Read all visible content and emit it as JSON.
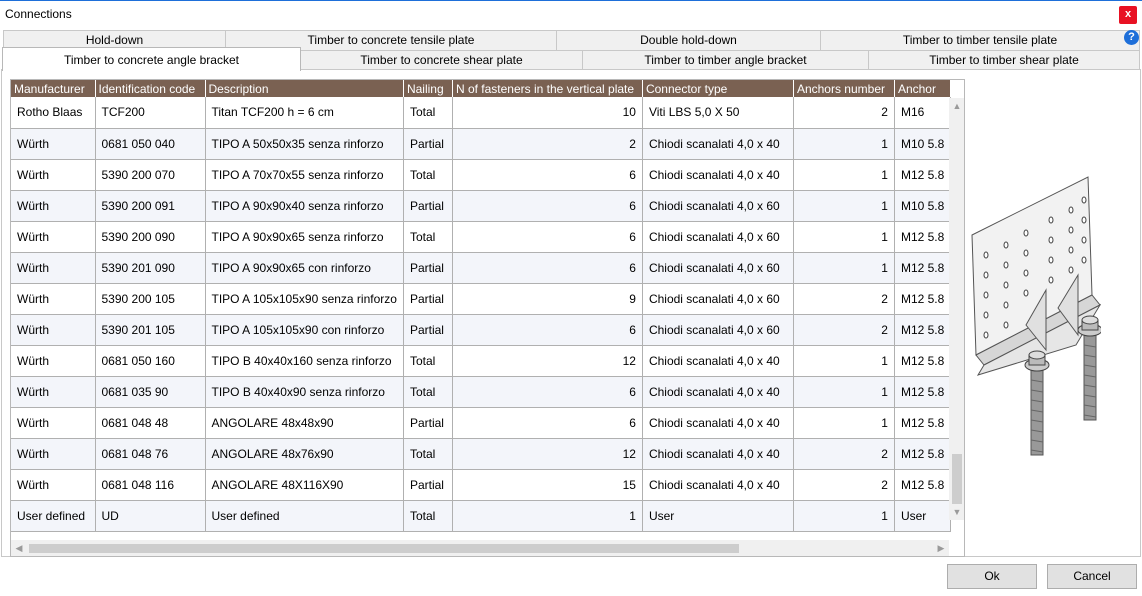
{
  "window": {
    "title": "Connections",
    "close_label": "x"
  },
  "tabs_row1": [
    {
      "label": "Hold-down"
    },
    {
      "label": "Timber to concrete tensile plate"
    },
    {
      "label": "Double hold-down"
    },
    {
      "label": "Timber to timber tensile plate"
    }
  ],
  "tabs_row2": [
    {
      "label": "Timber to concrete angle bracket",
      "active": true
    },
    {
      "label": "Timber to concrete shear plate"
    },
    {
      "label": "Timber to timber angle bracket"
    },
    {
      "label": "Timber to timber shear plate"
    }
  ],
  "help_icon": "?",
  "table": {
    "columns": [
      "Manufacturer",
      "Identification code",
      "Description",
      "Nailing",
      "N of fasteners in the vertical plate",
      "Connector type",
      "Anchors number",
      "Anchor"
    ],
    "rows": [
      [
        "Rotho Blaas",
        "TCF200",
        "Titan TCF200 h = 6 cm",
        "Total",
        "10",
        "Viti LBS 5,0 X 50",
        "2",
        "M16"
      ],
      [
        "Würth",
        "0681 050 040",
        "TIPO A 50x50x35 senza rinforzo",
        "Partial",
        "2",
        "Chiodi scanalati 4,0 x 40",
        "1",
        "M10 5.8"
      ],
      [
        "Würth",
        "5390 200 070",
        "TIPO A 70x70x55 senza rinforzo",
        "Total",
        "6",
        "Chiodi scanalati 4,0 x 40",
        "1",
        "M12 5.8"
      ],
      [
        "Würth",
        "5390 200 091",
        "TIPO A 90x90x40 senza rinforzo",
        "Partial",
        "6",
        "Chiodi scanalati 4,0 x 60",
        "1",
        "M10 5.8"
      ],
      [
        "Würth",
        "5390 200 090",
        "TIPO A 90x90x65 senza rinforzo",
        "Total",
        "6",
        "Chiodi scanalati 4,0 x 60",
        "1",
        "M12 5.8"
      ],
      [
        "Würth",
        "5390 201 090",
        "TIPO A 90x90x65 con rinforzo",
        "Partial",
        "6",
        "Chiodi scanalati 4,0 x 60",
        "1",
        "M12 5.8"
      ],
      [
        "Würth",
        "5390 200 105",
        "TIPO A 105x105x90 senza rinforzo",
        "Partial",
        "9",
        "Chiodi scanalati 4,0 x 60",
        "2",
        "M12 5.8"
      ],
      [
        "Würth",
        "5390 201 105",
        "TIPO A 105x105x90 con rinforzo",
        "Partial",
        "6",
        "Chiodi scanalati 4,0 x 60",
        "2",
        "M12 5.8"
      ],
      [
        "Würth",
        "0681  050 160",
        "TIPO B 40x40x160 senza rinforzo",
        "Total",
        "12",
        "Chiodi scanalati 4,0 x 40",
        "1",
        "M12 5.8"
      ],
      [
        "Würth",
        "0681  035 90",
        "TIPO B 40x40x90 senza rinforzo",
        "Total",
        "6",
        "Chiodi scanalati 4,0 x 40",
        "1",
        "M12 5.8"
      ],
      [
        "Würth",
        "0681  048 48",
        "ANGOLARE 48x48x90",
        "Partial",
        "6",
        "Chiodi scanalati 4,0 x 40",
        "1",
        "M12 5.8"
      ],
      [
        "Würth",
        "0681  048 76",
        "ANGOLARE 48x76x90",
        "Total",
        "12",
        "Chiodi scanalati 4,0 x 40",
        "2",
        "M12 5.8"
      ],
      [
        "Würth",
        "0681  048 116",
        "ANGOLARE 48X116X90",
        "Partial",
        "15",
        "Chiodi scanalati 4,0 x 40",
        "2",
        "M12 5.8"
      ],
      [
        "User defined",
        "UD",
        "User defined",
        "Total",
        "1",
        "User",
        "1",
        "User"
      ]
    ]
  },
  "buttons": {
    "ok": "Ok",
    "cancel": "Cancel"
  }
}
